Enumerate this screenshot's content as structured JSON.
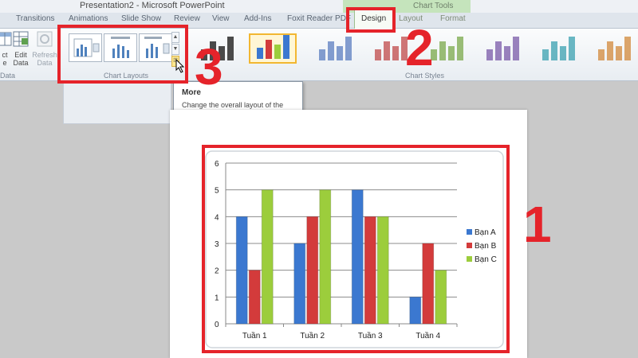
{
  "window": {
    "title": "Presentation2 - Microsoft PowerPoint",
    "contextual_tab_group": "Chart Tools"
  },
  "tabs": [
    {
      "label": "Transitions",
      "active": false
    },
    {
      "label": "Animations",
      "active": false
    },
    {
      "label": "Slide Show",
      "active": false
    },
    {
      "label": "Review",
      "active": false
    },
    {
      "label": "View",
      "active": false
    },
    {
      "label": "Add-Ins",
      "active": false
    },
    {
      "label": "Foxit Reader PDF",
      "active": false
    },
    {
      "label": "Design",
      "active": true
    },
    {
      "label": "Layout",
      "active": false
    },
    {
      "label": "Format",
      "active": false
    }
  ],
  "ribbon": {
    "data_group": {
      "label": "Data",
      "buttons": [
        {
          "label": "ct",
          "sub": "e",
          "icon": "switch-row-column-icon"
        },
        {
          "label": "Edit",
          "sub": "Data",
          "icon": "edit-data-icon"
        },
        {
          "label": "Refresh",
          "sub": "Data",
          "icon": "refresh-data-icon",
          "disabled": true
        }
      ]
    },
    "chart_layouts_group": {
      "label": "Chart Layouts",
      "more_button_icon": "more-chevron-icon"
    },
    "chart_styles_group": {
      "label": "Chart Styles",
      "style_colors": [
        "#4a4a4a",
        "#3b6fc4",
        "#5b7ec0",
        "#c04a4a",
        "#7aa84a",
        "#7a5aa8",
        "#3aa0b0",
        "#d2883a"
      ]
    }
  },
  "tooltip": {
    "title": "More",
    "body": "Change the overall layout of the chart."
  },
  "annotations": {
    "step_1": "1",
    "step_2": "2",
    "step_3": "3",
    "color": "#e5232a"
  },
  "chart_data": {
    "type": "bar",
    "categories": [
      "Tuần 1",
      "Tuần 2",
      "Tuần 3",
      "Tuần 4"
    ],
    "series": [
      {
        "name": "Bạn A",
        "values": [
          4,
          3,
          5,
          1
        ],
        "color": "#3b78d0"
      },
      {
        "name": "Bạn B",
        "values": [
          2,
          4,
          4,
          3
        ],
        "color": "#d33b3b"
      },
      {
        "name": "Bạn C",
        "values": [
          5,
          5,
          4,
          2
        ],
        "color": "#9ccd3c"
      }
    ],
    "ylim": [
      0,
      6
    ],
    "yticks": [
      "0",
      "1",
      "2",
      "3",
      "4",
      "5",
      "6"
    ],
    "grid": true,
    "legend_position": "right"
  }
}
